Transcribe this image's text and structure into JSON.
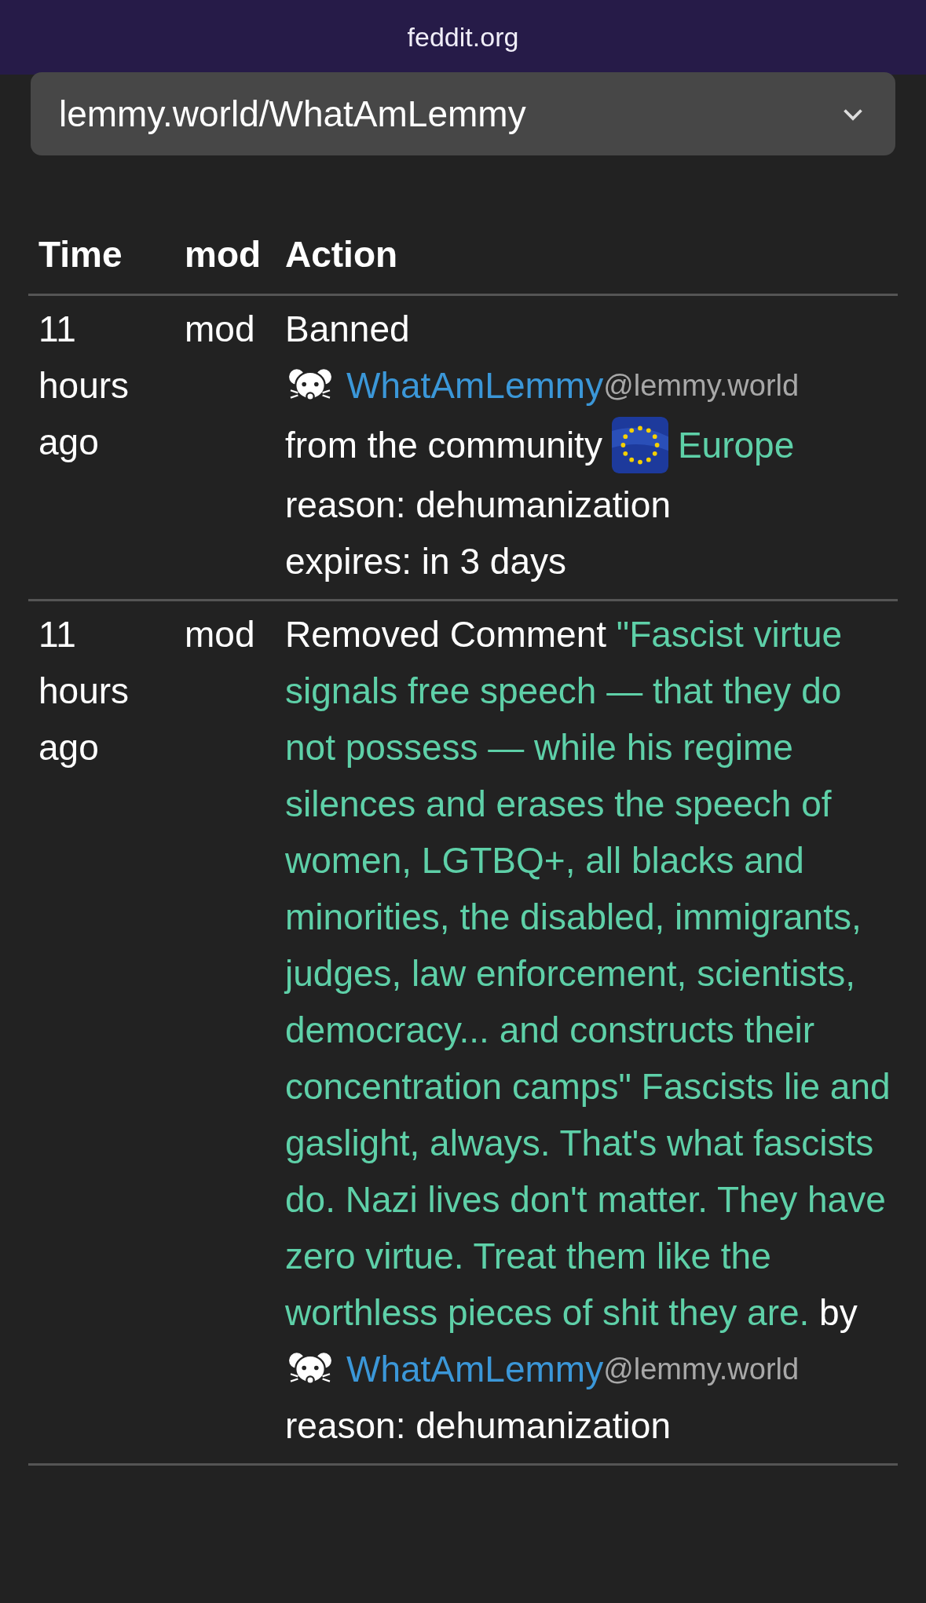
{
  "top_bar": {
    "domain": "feddit.org"
  },
  "community_select": {
    "value": "lemmy.world/WhatAmLemmy"
  },
  "table": {
    "columns": [
      "Time",
      "mod",
      "Action"
    ],
    "rows": [
      {
        "time": "11 hours ago",
        "mod": "mod",
        "action": {
          "kind": "ban",
          "verb": "Banned",
          "user": {
            "name": "WhatAmLemmy",
            "instance": "@lemmy.world"
          },
          "community_prefix": "from the community",
          "community": "Europe",
          "reason": "reason: dehumanization",
          "expires": "expires: in 3 days"
        }
      },
      {
        "time": "11 hours ago",
        "mod": "mod",
        "action": {
          "kind": "remove_comment",
          "verb": "Removed Comment",
          "comment": "\"Fascist virtue signals free speech — that they do not possess — while his regime silences and erases the speech of women, LGTBQ+, all blacks and minorities, the disabled, immigrants, judges, law enforcement, scientists, democracy... and constructs their concentration camps\" Fascists lie and gaslight, always. That's what fascists do. Nazi lives don't matter. They have zero virtue. Treat them like the worthless pieces of shit they are.",
          "by": "by",
          "user": {
            "name": "WhatAmLemmy",
            "instance": "@lemmy.world"
          },
          "reason": "reason: dehumanization"
        }
      }
    ]
  }
}
